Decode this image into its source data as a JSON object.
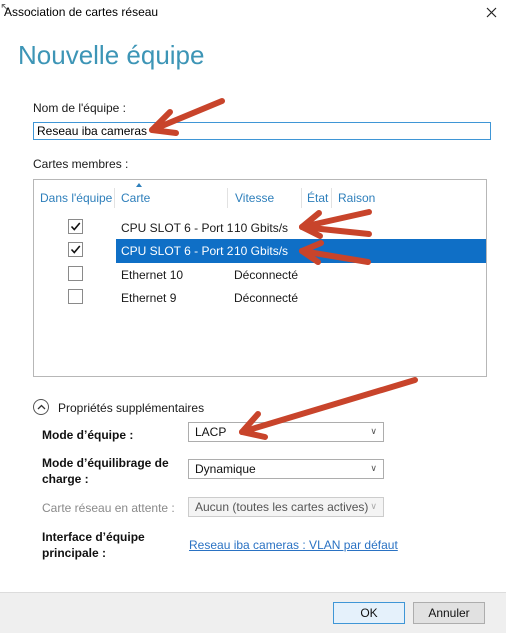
{
  "window": {
    "title": "Association de cartes réseau"
  },
  "page": {
    "heading": "Nouvelle équipe"
  },
  "team_name": {
    "label": "Nom de l'équipe :",
    "value": "Reseau iba cameras"
  },
  "members": {
    "label": "Cartes membres :",
    "columns": [
      "Dans l'équipe",
      "Carte",
      "Vitesse",
      "État",
      "Raison"
    ],
    "sort_column": "Carte",
    "rows": [
      {
        "checked": true,
        "card": "CPU SLOT 6 - Port 1",
        "speed": "10 Gbits/s",
        "state": "",
        "reason": "",
        "selected": false
      },
      {
        "checked": true,
        "card": "CPU SLOT 6 - Port 2",
        "speed": "10 Gbits/s",
        "state": "",
        "reason": "",
        "selected": true
      },
      {
        "checked": false,
        "card": "Ethernet 10",
        "speed": "Déconnecté",
        "state": "",
        "reason": "",
        "selected": false
      },
      {
        "checked": false,
        "card": "Ethernet 9",
        "speed": "Déconnecté",
        "state": "",
        "reason": "",
        "selected": false
      }
    ]
  },
  "properties": {
    "toggle_label": "Propriétés supplémentaires",
    "team_mode": {
      "label": "Mode d’équipe :",
      "value": "LACP"
    },
    "load_balancing": {
      "label": "Mode d’équilibrage de charge :",
      "value": "Dynamique"
    },
    "standby": {
      "label": "Carte réseau en attente :",
      "value": "Aucun (toutes les cartes actives)"
    },
    "primary_interface": {
      "label": "Interface d’équipe principale :",
      "value": "Reseau iba cameras : VLAN par défaut"
    }
  },
  "buttons": {
    "ok": "OK",
    "cancel": "Annuler"
  },
  "annotations": {
    "arrow_color": "#c8442b"
  },
  "icons": {
    "close": "close-icon",
    "check": "check-icon",
    "expander": "chevron-up-icon",
    "dropdown": "chevron-down-icon"
  }
}
